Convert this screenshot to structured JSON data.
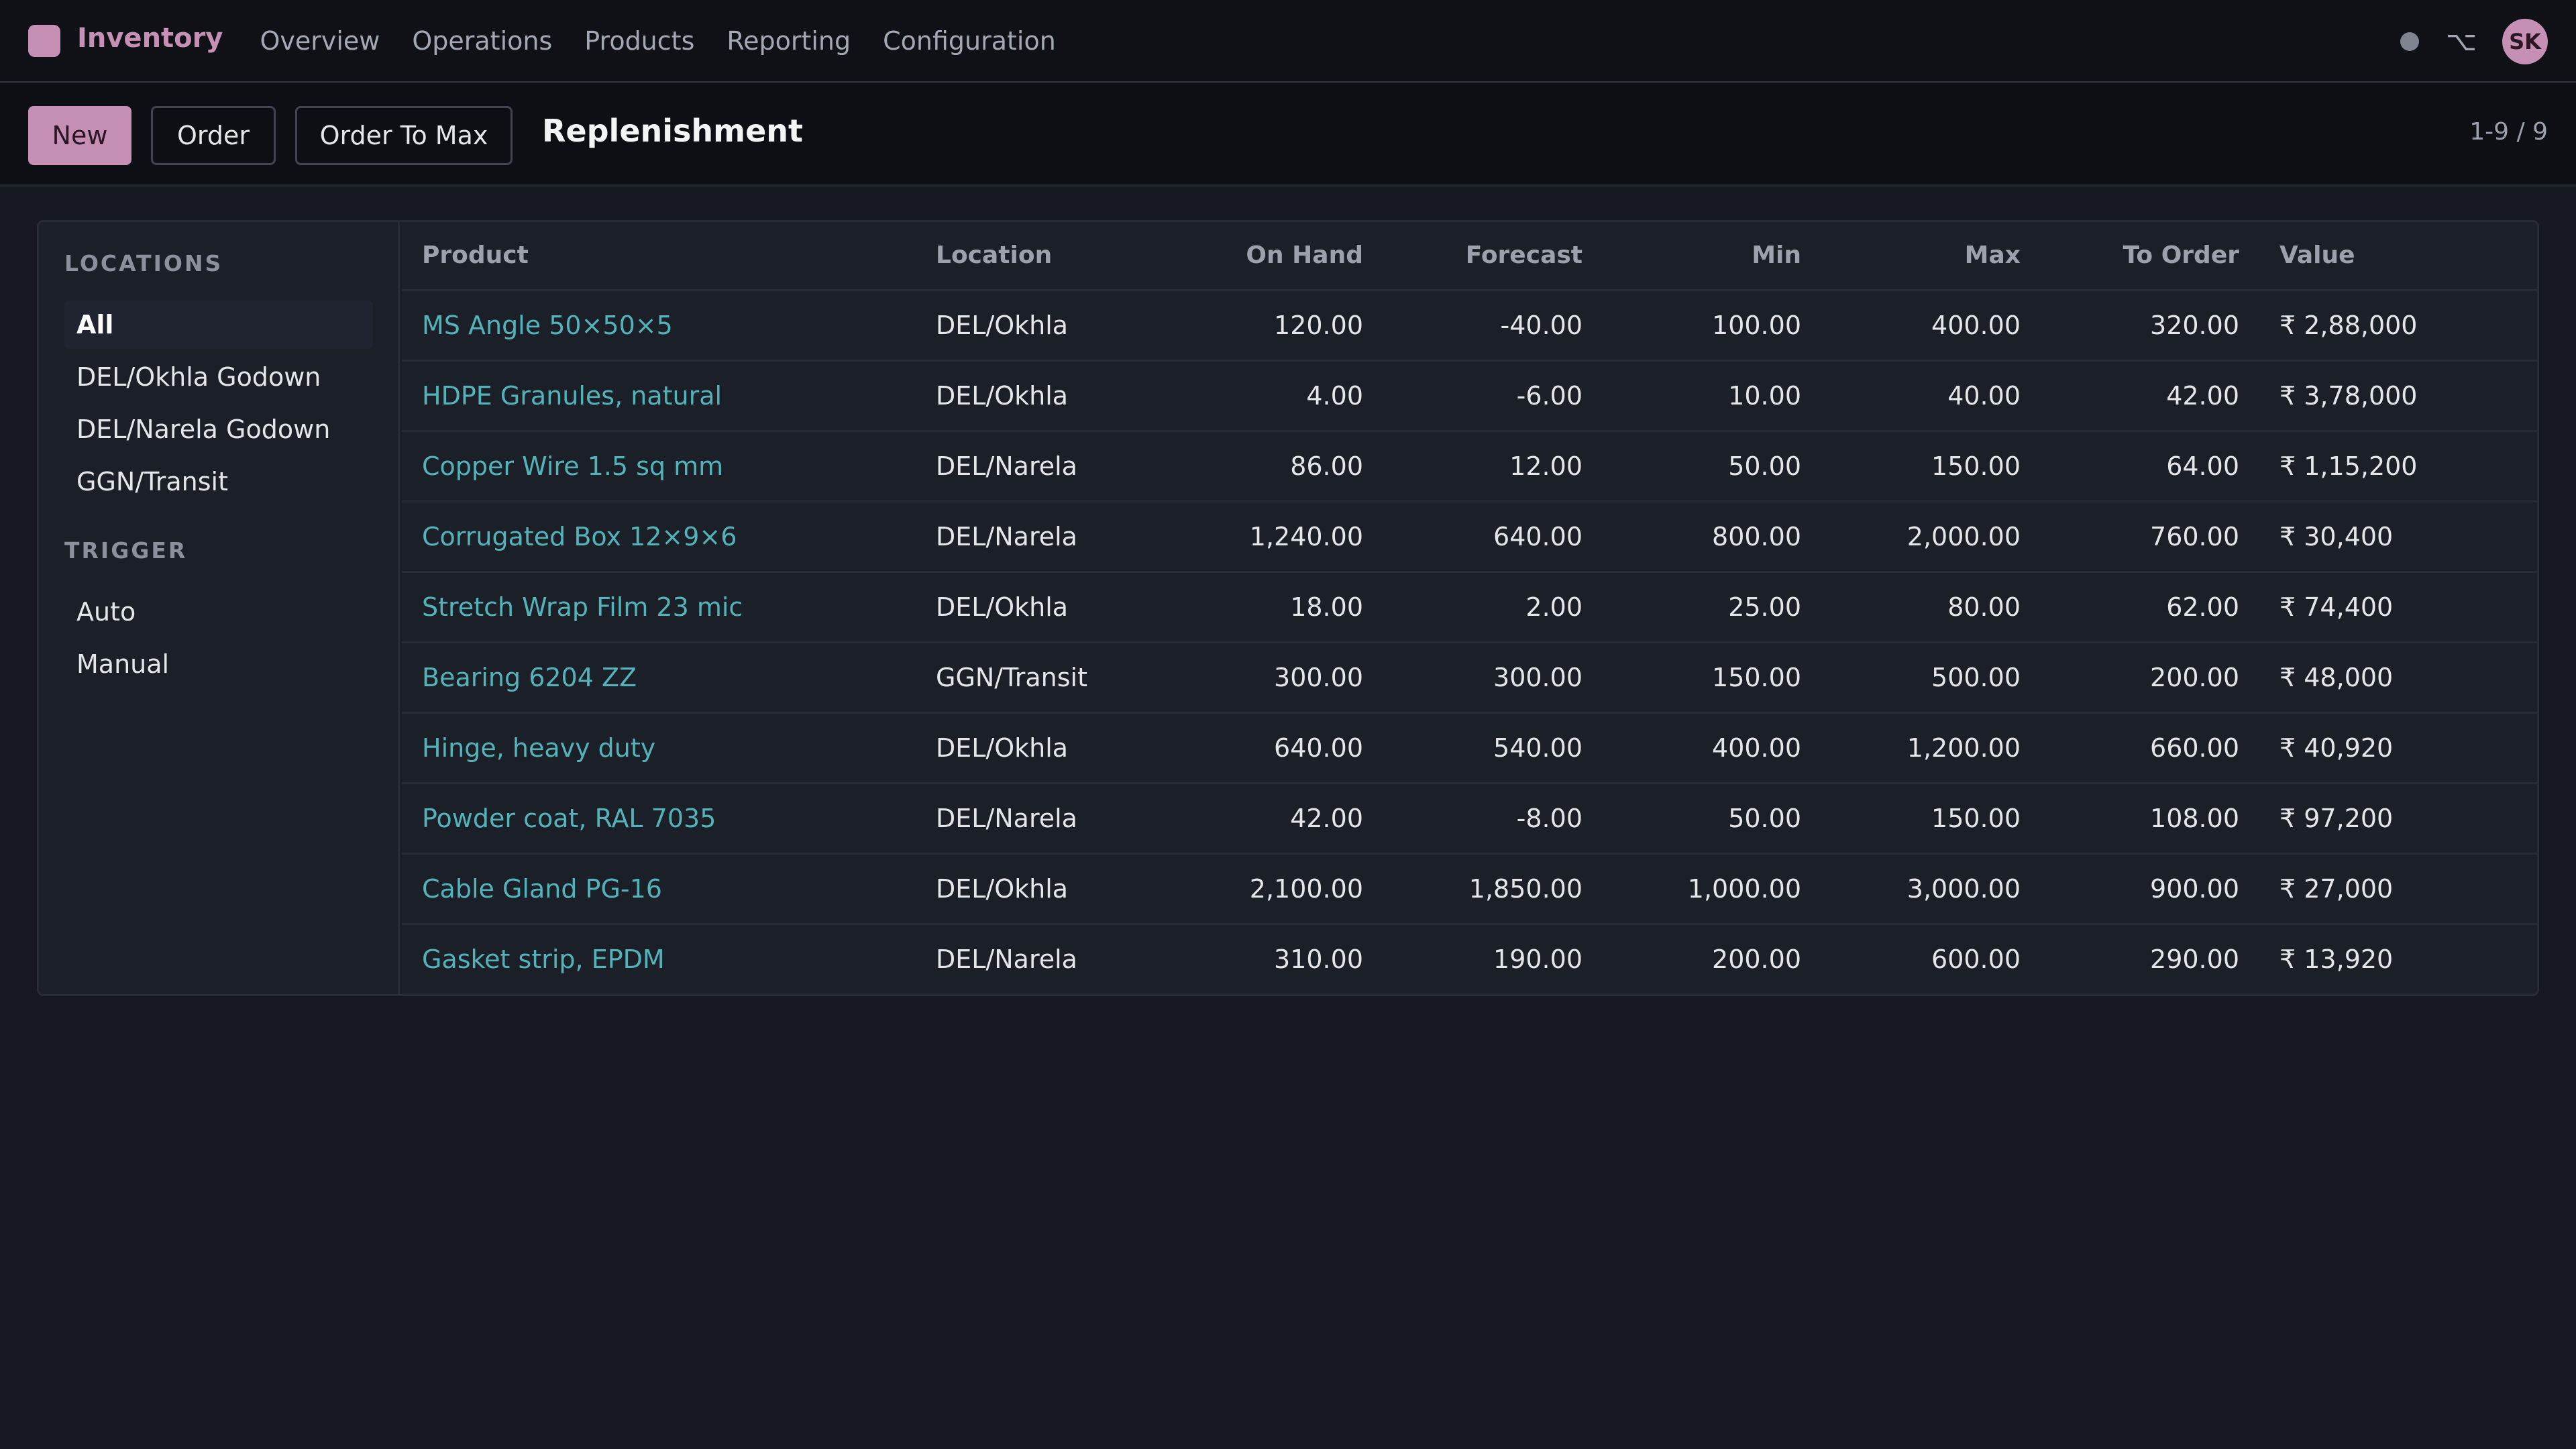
{
  "navbar": {
    "app_name": "Inventory",
    "menu": [
      "Overview",
      "Operations",
      "Products",
      "Reporting",
      "Configuration"
    ],
    "option_glyph": "⌥",
    "user_initials": "SK"
  },
  "control_panel": {
    "new_label": "New",
    "order_label": "Order",
    "order_max_label": "Order To Max",
    "title": "Replenishment",
    "pager": "1-9 / 9"
  },
  "sidebar": {
    "locations_heading": "LOCATIONS",
    "locations": [
      "All",
      "DEL/Okhla Godown",
      "DEL/Narela Godown",
      "GGN/Transit"
    ],
    "trigger_heading": "TRIGGER",
    "triggers": [
      "Auto",
      "Manual"
    ]
  },
  "table": {
    "headers": [
      "Product",
      "Location",
      "On Hand",
      "Forecast",
      "Min",
      "Max",
      "To Order",
      "Value"
    ],
    "rows": [
      [
        "MS Angle 50×50×5",
        "DEL/Okhla",
        "120.00",
        "-40.00",
        "100.00",
        "400.00",
        "320.00",
        "₹ 2,88,000"
      ],
      [
        "HDPE Granules, natural",
        "DEL/Okhla",
        "4.00",
        "-6.00",
        "10.00",
        "40.00",
        "42.00",
        "₹ 3,78,000"
      ],
      [
        "Copper Wire 1.5 sq mm",
        "DEL/Narela",
        "86.00",
        "12.00",
        "50.00",
        "150.00",
        "64.00",
        "₹ 1,15,200"
      ],
      [
        "Corrugated Box 12×9×6",
        "DEL/Narela",
        "1,240.00",
        "640.00",
        "800.00",
        "2,000.00",
        "760.00",
        "₹ 30,400"
      ],
      [
        "Stretch Wrap Film 23 mic",
        "DEL/Okhla",
        "18.00",
        "2.00",
        "25.00",
        "80.00",
        "62.00",
        "₹ 74,400"
      ],
      [
        "Bearing 6204 ZZ",
        "GGN/Transit",
        "300.00",
        "300.00",
        "150.00",
        "500.00",
        "200.00",
        "₹ 48,000"
      ],
      [
        "Hinge, heavy duty",
        "DEL/Okhla",
        "640.00",
        "540.00",
        "400.00",
        "1,200.00",
        "660.00",
        "₹ 40,920"
      ],
      [
        "Powder coat, RAL 7035",
        "DEL/Narela",
        "42.00",
        "-8.00",
        "50.00",
        "150.00",
        "108.00",
        "₹ 97,200"
      ],
      [
        "Cable Gland PG-16",
        "DEL/Okhla",
        "2,100.00",
        "1,850.00",
        "1,000.00",
        "3,000.00",
        "900.00",
        "₹ 27,000"
      ],
      [
        "Gasket strip, EPDM",
        "DEL/Narela",
        "310.00",
        "190.00",
        "200.00",
        "600.00",
        "290.00",
        "₹ 13,920"
      ]
    ]
  },
  "colors": {
    "accent": "#c690b5",
    "link": "#54b3b8",
    "background": "#161922",
    "navbar": "#0f1117"
  }
}
